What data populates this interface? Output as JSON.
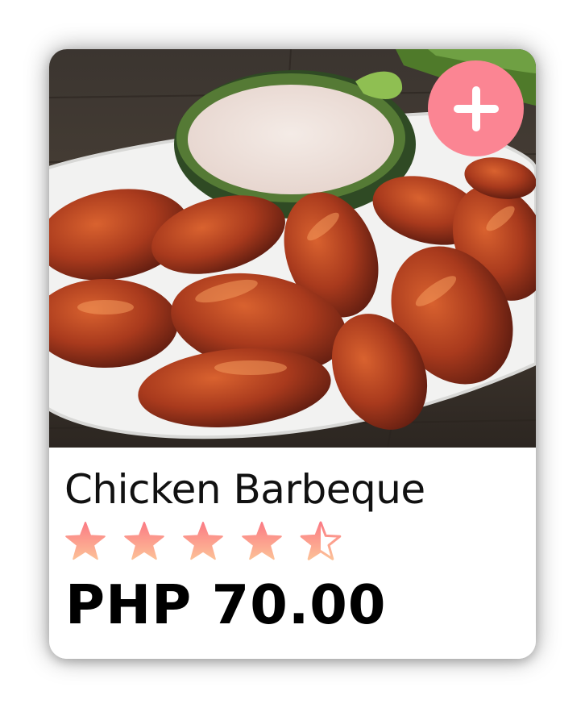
{
  "product": {
    "name": "Chicken Barbeque",
    "price": "PHP 70.00",
    "rating": 4.5,
    "max_rating": 5
  },
  "icons": {
    "add": "plus-icon",
    "star_full": "star-icon",
    "star_half": "star-half-icon"
  },
  "colors": {
    "accent": "#fb8593",
    "star_top": "#fb7b84",
    "star_bottom": "#fcc097",
    "price_text": "#000000",
    "title_text": "#111111"
  }
}
